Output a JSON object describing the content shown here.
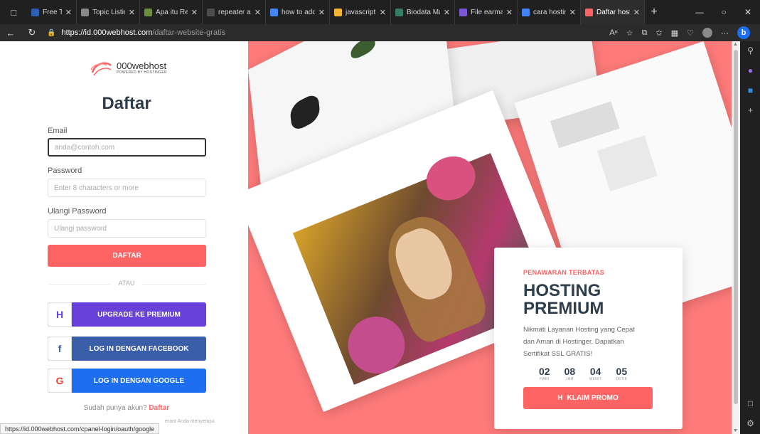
{
  "browser": {
    "tabs": [
      {
        "title": "Free Templa",
        "color": "#2f5fb3"
      },
      {
        "title": "Topic Listing",
        "color": "#888888"
      },
      {
        "title": "Apa itu Rep",
        "color": "#6a8f3a"
      },
      {
        "title": "repeater ad",
        "color": "#4d4d4d"
      },
      {
        "title": "how to add",
        "color": "#4285f4"
      },
      {
        "title": "javascript -",
        "color": "#f2b632"
      },
      {
        "title": "Biodata Ma",
        "color": "#3a7c6a"
      },
      {
        "title": "File earmar",
        "color": "#7b57d6"
      },
      {
        "title": "cara hostin",
        "color": "#4285f4"
      },
      {
        "title": "Daftar host",
        "color": "#ff6464"
      }
    ],
    "active_tab_index": 9,
    "url_host": "https://id.000webhost.com",
    "url_path": "/daftar-website-gratis",
    "status_url": "https://id.000webhost.com/cpanel-login/oauth/google"
  },
  "logo": {
    "brand": "000webhost",
    "sub": "POWERED BY HOSTINGER"
  },
  "form": {
    "title": "Daftar",
    "email_label": "Email",
    "email_placeholder": "anda@contoh.com",
    "password_label": "Password",
    "password_placeholder": "Enter 8 characters or more",
    "repeat_label": "Ulangi Password",
    "repeat_placeholder": "Ulangi password",
    "submit_label": "DAFTAR",
    "or_label": "ATAU",
    "premium_label": "UPGRADE KE PREMIUM",
    "facebook_label": "LOG IN DENGAN FACEBOOK",
    "google_label": "LOG IN DENGAN GOOGLE",
    "have_account": "Sudah punya akun?",
    "login_link": "Daftar",
    "terms_fragment": "erant Anda menyetujui"
  },
  "promo": {
    "eyebrow": "PENAWARAN TERBATAS",
    "title_line1": "HOSTING",
    "title_line2": "PREMIUM",
    "description": "Nikmati Layanan Hosting yang Cepat dan Aman di Hostinger. Dapatkan Sertifikat SSL GRATIS!",
    "countdown": [
      {
        "value": "02",
        "unit": "HARI"
      },
      {
        "value": "08",
        "unit": "JAM"
      },
      {
        "value": "04",
        "unit": "MENIT"
      },
      {
        "value": "05",
        "unit": "DETIK"
      }
    ],
    "cta_label": "KLAIM PROMO"
  },
  "colors": {
    "accent": "#ff6464",
    "hero_bg": "#ff7b7b",
    "premium": "#6741d9",
    "facebook": "#3b5ea8",
    "google": "#1e6ef0",
    "heading": "#2f3e4c"
  }
}
